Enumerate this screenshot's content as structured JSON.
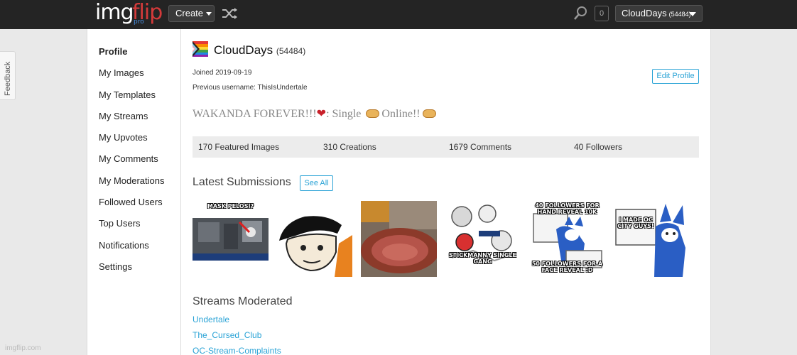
{
  "header": {
    "logo_main": "img",
    "logo_accent": "flip",
    "logo_badge": "pro",
    "create_label": "Create",
    "notification_count": "0",
    "user_name": "CloudDays",
    "user_points": "(54484)"
  },
  "feedback_label": "Feedback",
  "footer_text": "imgflip.com",
  "sidebar": {
    "items": [
      {
        "label": "Profile",
        "active": true
      },
      {
        "label": "My Images"
      },
      {
        "label": "My Templates"
      },
      {
        "label": "My Streams"
      },
      {
        "label": "My Upvotes"
      },
      {
        "label": "My Comments"
      },
      {
        "label": "My Moderations"
      },
      {
        "label": "Followed Users"
      },
      {
        "label": "Top Users"
      },
      {
        "label": "Notifications"
      },
      {
        "label": "Settings"
      }
    ]
  },
  "profile": {
    "username": "CloudDays",
    "points": "(54484)",
    "joined": "Joined 2019-09-19",
    "previous_username": "Previous username: ThisIsUndertale",
    "edit_label": "Edit Profile",
    "bio_part1": "WAKANDA FOREVER!!!",
    "bio_part2": ": Single",
    "bio_part3": "Online!!"
  },
  "stats": {
    "featured": "170 Featured Images",
    "creations": "310 Creations",
    "comments": "1679 Comments",
    "followers": "40 Followers"
  },
  "latest": {
    "title": "Latest Submissions",
    "see_all": "See All",
    "thumbs": [
      {
        "caption": "MASK PELOSI?"
      },
      {
        "caption": ""
      },
      {
        "caption": ""
      },
      {
        "caption": "STICKMANNY SINGLE GANG"
      },
      {
        "caption_top": "40 FOLLOWERS FOR HAND REVEAL 10K",
        "caption_bottom": "50 FOLLOWERS FOR A FACE REVEAL :D"
      },
      {
        "caption": "I MADE OC CITY GUYS!"
      }
    ]
  },
  "streams": {
    "title": "Streams Moderated",
    "items": [
      "Undertale",
      "The_Cursed_Club",
      "OC-Stream-Complaints"
    ]
  }
}
